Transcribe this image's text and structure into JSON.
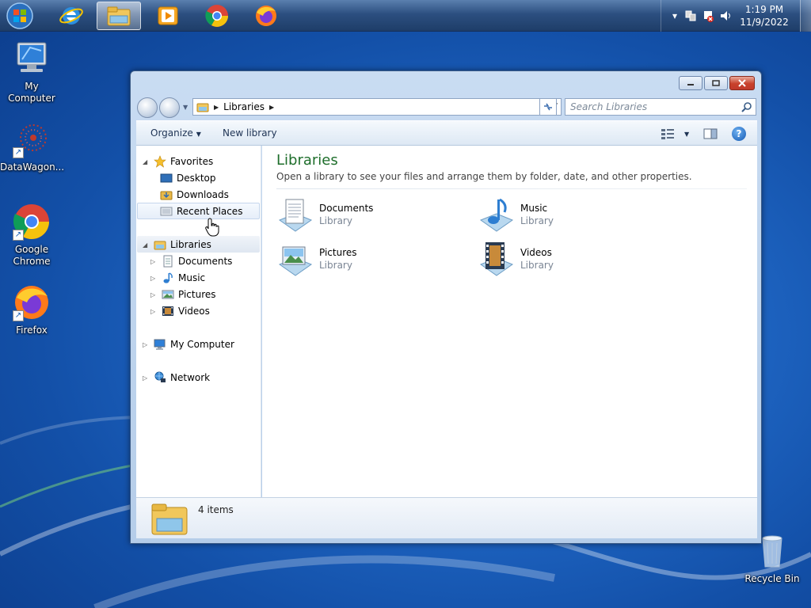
{
  "taskbar": {
    "clock_time": "1:19 PM",
    "clock_date": "11/9/2022",
    "apps": [
      {
        "name": "internet-explorer"
      },
      {
        "name": "file-explorer",
        "active": true
      },
      {
        "name": "media-player"
      },
      {
        "name": "google-chrome"
      },
      {
        "name": "firefox"
      }
    ]
  },
  "desktop": {
    "icons": [
      {
        "label": "My Computer"
      },
      {
        "label": "DataWagon..."
      },
      {
        "label": "Google Chrome"
      },
      {
        "label": "Firefox"
      },
      {
        "label": "Recycle Bin"
      }
    ]
  },
  "window": {
    "address": {
      "segment": "Libraries"
    },
    "search_placeholder": "Search Libraries",
    "toolbar": {
      "organize": "Organize",
      "new_library": "New library"
    },
    "nav": {
      "favorites": "Favorites",
      "desktop": "Desktop",
      "downloads": "Downloads",
      "recent_places": "Recent Places",
      "libraries": "Libraries",
      "documents": "Documents",
      "music": "Music",
      "pictures": "Pictures",
      "videos": "Videos",
      "my_computer": "My Computer",
      "network": "Network"
    },
    "content": {
      "title": "Libraries",
      "description": "Open a library to see your files and arrange them by folder, date, and other properties.",
      "items": [
        {
          "name": "Documents",
          "type": "Library"
        },
        {
          "name": "Music",
          "type": "Library"
        },
        {
          "name": "Pictures",
          "type": "Library"
        },
        {
          "name": "Videos",
          "type": "Library"
        }
      ]
    },
    "details": {
      "count": "4 items"
    }
  },
  "colors": {
    "title_green": "#1e6e2b",
    "desktop_blue": "#1f66c4"
  }
}
